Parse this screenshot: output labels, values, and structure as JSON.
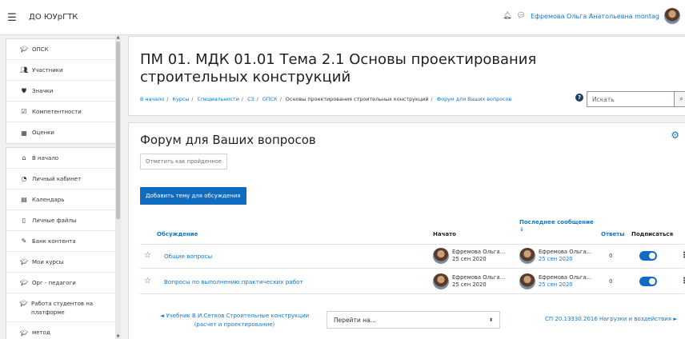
{
  "navbar": {
    "menu_icon": "hamburger-icon",
    "site_name": "ДО ЮУрГТК",
    "user_name": "Ефремова Ольга Анатольевна montag"
  },
  "sidebar": {
    "groups": [
      [
        {
          "icon": "graduation-cap-icon",
          "label": "ОПСК"
        },
        {
          "icon": "users-icon",
          "label": "Участники"
        },
        {
          "icon": "shield-icon",
          "label": "Значки"
        },
        {
          "icon": "checkbox-icon",
          "label": "Компетентности"
        },
        {
          "icon": "table-icon",
          "label": "Оценки"
        }
      ],
      [
        {
          "icon": "home-icon",
          "label": "В начало"
        },
        {
          "icon": "dashboard-icon",
          "label": "Личный кабинет"
        },
        {
          "icon": "calendar-icon",
          "label": "Календарь"
        },
        {
          "icon": "file-icon",
          "label": "Личные файлы"
        },
        {
          "icon": "pen-icon",
          "label": "Банк контента"
        },
        {
          "icon": "graduation-cap-icon",
          "label": "Мои курсы"
        },
        {
          "icon": "graduation-cap-icon",
          "label": "Орг - педагоги"
        },
        {
          "icon": "graduation-cap-icon",
          "label": "Работа студентов на платформе"
        },
        {
          "icon": "graduation-cap-icon",
          "label": "метод"
        }
      ]
    ]
  },
  "header": {
    "title": "ПМ 01. МДК 01.01 Тема 2.1 Основы проектирования строительных конструкций",
    "breadcrumb": [
      "В начало",
      "Курсы",
      "Специальности",
      "СЗ",
      "ОПСК",
      "Основы проектирования строительных конструкций",
      "Форум для Ваших вопросов"
    ],
    "search_placeholder": "Искать"
  },
  "forum": {
    "title": "Форум для Ваших вопросов",
    "mark_done_label": "Отметить как пройденное",
    "add_topic_label": "Добавить тему для обсуждения",
    "columns": {
      "discussion": "Обсуждение",
      "started": "Начато",
      "last_post": "Последнее сообщение ↓",
      "replies": "Ответы",
      "subscribe": "Подписаться"
    },
    "rows": [
      {
        "topic": "Общие вопросы",
        "start_user": "Ефремова Ольга...",
        "start_date": "25 сен 2020",
        "last_user": "Ефремова Ольга...",
        "last_date": "25 сен 2020",
        "replies": "0",
        "subscribed": true
      },
      {
        "topic": "Вопросы по выполнению практических работ",
        "start_user": "Ефремова Ольга...",
        "start_date": "25 сен 2020",
        "last_user": "Ефремова Ольга...",
        "last_date": "25 сен 2020",
        "replies": "0",
        "subscribed": true
      }
    ],
    "prev_activity": "◄ Учебник В.И.Сетков Строительные конструкции (расчет и проектирование)",
    "jump_to": "Перейти на...",
    "next_activity": "СП 20.13330.2016 Нагрузки и воздействия ►"
  },
  "colors": {
    "accent": "#0f6cbf",
    "link": "#1177d1",
    "page_bg": "#f1f1f1"
  }
}
